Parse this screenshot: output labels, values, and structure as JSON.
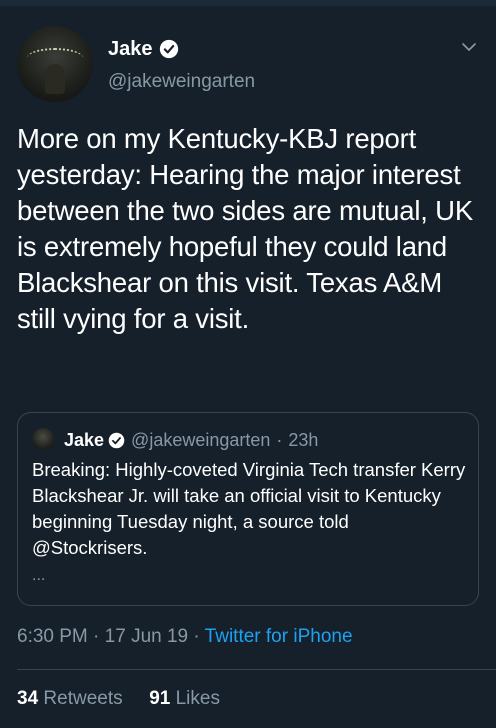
{
  "author": {
    "name": "Jake",
    "handle": "@jakeweingarten"
  },
  "tweet": {
    "text": "More on my Kentucky-KBJ report yesterday: Hearing the major interest between the two sides are mutual, UK is extremely hopeful they could land Blackshear on this visit. Texas A&M still vying for a visit."
  },
  "quoted_tweet": {
    "name": "Jake",
    "handle": "@jakeweingarten",
    "time": "23h",
    "text": "Breaking: Highly-coveted Virginia Tech transfer Kerry Blackshear Jr. will take an official visit to Kentucky beginning Tuesday night, a source told @Stockrisers.",
    "more": "..."
  },
  "meta": {
    "time": "6:30 PM",
    "date": "17 Jun 19",
    "source": "Twitter for iPhone"
  },
  "stats": {
    "retweets_count": "34",
    "retweets_label": "Retweets",
    "likes_count": "91",
    "likes_label": "Likes"
  },
  "colors": {
    "background": "#15202b",
    "secondary_text": "#8899a6",
    "accent": "#1da1f2",
    "border": "#38444d"
  },
  "icons": {
    "verified": "verified-badge-icon",
    "menu": "chevron-down-icon"
  }
}
